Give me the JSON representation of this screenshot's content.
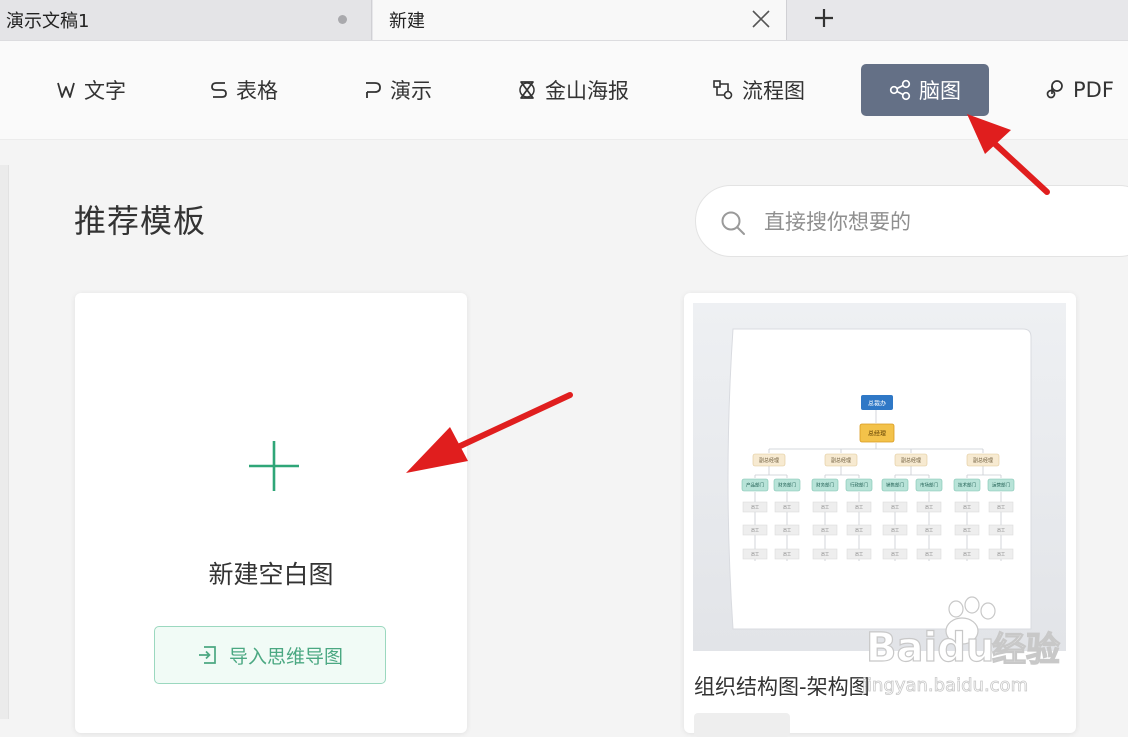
{
  "tabs": [
    {
      "label": "演示文稿1"
    },
    {
      "label": "新建"
    }
  ],
  "categories": [
    {
      "label": "文字",
      "icon": "w-letter-icon"
    },
    {
      "label": "表格",
      "icon": "s-letter-icon"
    },
    {
      "label": "演示",
      "icon": "p-letter-icon"
    },
    {
      "label": "金山海报",
      "icon": "poster-icon"
    },
    {
      "label": "流程图",
      "icon": "flowchart-icon"
    },
    {
      "label": "脑图",
      "icon": "mindmap-icon",
      "active": true
    },
    {
      "label": "PDF",
      "icon": "pdf-icon"
    }
  ],
  "section": {
    "title": "推荐模板"
  },
  "search": {
    "placeholder": "直接搜你想要的"
  },
  "blank_card": {
    "label": "新建空白图",
    "import_label": "导入思维导图"
  },
  "template_card": {
    "label": "组织结构图-架构图",
    "preview": {
      "top_node": "总裁办",
      "second_node": "总经理",
      "level3": [
        "副总经理",
        "副总经理",
        "副总经理",
        "副总经理"
      ],
      "departments": [
        "产品部门",
        "财务部门",
        "财务部门",
        "行政部门",
        "销售部门",
        "市场部门",
        "技术部门",
        "运营部门"
      ],
      "staff": [
        "员工",
        "员工",
        "员工"
      ]
    }
  },
  "watermark": {
    "brand": "Baidu",
    "text": "经验",
    "url": "jingyan.baidu.com"
  },
  "colors": {
    "active_category_bg": "#647086",
    "accent_green": "#2fa678",
    "arrow_red": "#e01e1e"
  }
}
